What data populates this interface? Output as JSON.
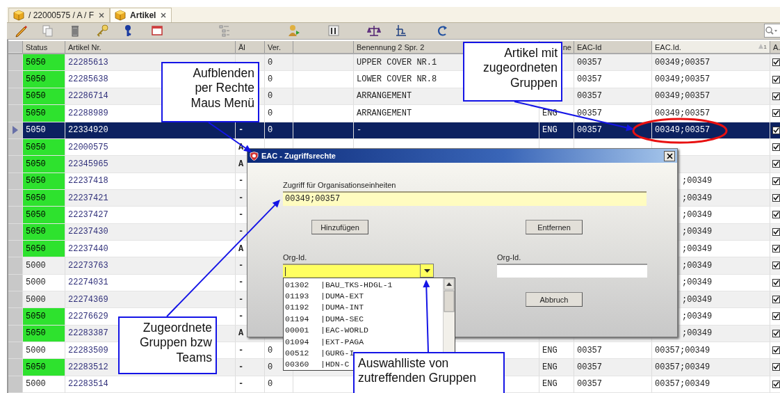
{
  "tabs": [
    {
      "label": "/ 22000575 / A / F",
      "selected": false
    },
    {
      "label": "Artikel",
      "selected": true
    }
  ],
  "table": {
    "columns": [
      {
        "label": "Status",
        "sorted": false
      },
      {
        "label": "Artikel Nr.",
        "sorted": false
      },
      {
        "label": "Äl",
        "sorted": false
      },
      {
        "label": "Ver.",
        "sorted": false
      },
      {
        "sorted": false
      },
      {
        "label": "Benennung 2 Spr. 2",
        "sorted": false
      },
      {
        "label": "ne",
        "sorted": false
      },
      {
        "label": "EAC-Id",
        "sorted": false
      },
      {
        "label": "EAC.Id.",
        "sorted": true,
        "sort_rank": "1"
      },
      {
        "label": "A.",
        "sorted": false
      }
    ],
    "rows": [
      {
        "selected": false,
        "status_highlight": true,
        "partly_covered": false,
        "checked": true,
        "cells": [
          "5050",
          "22285613",
          null,
          "0",
          null,
          "UPPER COVER NR.1",
          null,
          "00357",
          "00349;00357"
        ]
      },
      {
        "selected": false,
        "status_highlight": true,
        "partly_covered": false,
        "checked": true,
        "cells": [
          "5050",
          "22285638",
          null,
          "0",
          null,
          "LOWER COVER NR.8",
          null,
          "00357",
          "00349;00357"
        ]
      },
      {
        "selected": false,
        "status_highlight": true,
        "partly_covered": false,
        "checked": true,
        "cells": [
          "5050",
          "22286714",
          null,
          "0",
          null,
          "ARRANGEMENT",
          null,
          "00357",
          "00349;00357"
        ]
      },
      {
        "selected": false,
        "status_highlight": true,
        "partly_covered": false,
        "checked": true,
        "cells": [
          "5050",
          "22288989",
          null,
          "0",
          null,
          "ARRANGEMENT",
          "ENG",
          "00357",
          "00349;00357"
        ]
      },
      {
        "selected": true,
        "status_highlight": false,
        "partly_covered": false,
        "checked": true,
        "cells": [
          "5050",
          "22334920",
          "-",
          "0",
          null,
          "-",
          "ENG",
          "00357",
          "00349;00357"
        ]
      },
      {
        "selected": false,
        "status_highlight": true,
        "partly_covered": false,
        "checked": true,
        "cells": [
          "5050",
          "22000575",
          "A",
          null,
          null,
          null,
          null,
          null,
          null
        ]
      },
      {
        "selected": false,
        "status_highlight": true,
        "partly_covered": false,
        "checked": true,
        "cells": [
          "5050",
          "22345965",
          "A",
          null,
          null,
          null,
          null,
          null,
          null
        ]
      },
      {
        "selected": false,
        "status_highlight": true,
        "partly_covered": true,
        "checked": true,
        "cells": [
          "5050",
          "22237418",
          "-",
          null,
          null,
          null,
          null,
          null,
          ";00349"
        ]
      },
      {
        "selected": false,
        "status_highlight": true,
        "partly_covered": true,
        "checked": true,
        "cells": [
          "5050",
          "22237421",
          "-",
          null,
          null,
          null,
          null,
          null,
          ";00349"
        ]
      },
      {
        "selected": false,
        "status_highlight": true,
        "partly_covered": true,
        "checked": true,
        "cells": [
          "5050",
          "22237427",
          "-",
          null,
          null,
          null,
          null,
          null,
          ";00349"
        ]
      },
      {
        "selected": false,
        "status_highlight": true,
        "partly_covered": true,
        "checked": true,
        "cells": [
          "5050",
          "22237430",
          "-",
          null,
          null,
          null,
          null,
          null,
          ";00349"
        ]
      },
      {
        "selected": false,
        "status_highlight": true,
        "partly_covered": true,
        "checked": true,
        "cells": [
          "5050",
          "22237440",
          "A",
          null,
          null,
          null,
          null,
          null,
          ";00349"
        ]
      },
      {
        "selected": false,
        "status_highlight": false,
        "partly_covered": true,
        "checked": true,
        "cells": [
          "5000",
          "22273763",
          "-",
          null,
          null,
          null,
          null,
          null,
          ";00349"
        ]
      },
      {
        "selected": false,
        "status_highlight": false,
        "partly_covered": true,
        "checked": true,
        "cells": [
          "5000",
          "22274031",
          "-",
          null,
          null,
          null,
          null,
          null,
          ";00349"
        ]
      },
      {
        "selected": false,
        "status_highlight": false,
        "partly_covered": true,
        "checked": true,
        "cells": [
          "5000",
          "22274369",
          "-",
          null,
          null,
          null,
          null,
          null,
          ";00349"
        ]
      },
      {
        "selected": false,
        "status_highlight": true,
        "partly_covered": true,
        "checked": true,
        "cells": [
          "5050",
          "22276629",
          "-",
          null,
          null,
          null,
          null,
          null,
          ";00349"
        ]
      },
      {
        "selected": false,
        "status_highlight": true,
        "partly_covered": true,
        "checked": true,
        "cells": [
          "5050",
          "22283387",
          "A",
          null,
          null,
          null,
          null,
          null,
          ";00349"
        ]
      },
      {
        "selected": false,
        "status_highlight": false,
        "partly_covered": false,
        "checked": true,
        "cells": [
          "5000",
          "22283509",
          "-",
          "0",
          null,
          null,
          "ENG",
          "00357",
          "00357;00349"
        ]
      },
      {
        "selected": false,
        "status_highlight": true,
        "partly_covered": false,
        "checked": true,
        "cells": [
          "5050",
          "22283512",
          "-",
          "0",
          null,
          null,
          "ENG",
          "00357",
          "00357;00349"
        ]
      },
      {
        "selected": false,
        "status_highlight": false,
        "partly_covered": false,
        "checked": true,
        "cells": [
          "5000",
          "22283514",
          "-",
          "0",
          null,
          null,
          "ENG",
          "00357",
          "00357;00349"
        ]
      }
    ]
  },
  "dialog": {
    "title": "EAC - Zugriffsrechte",
    "access_label": "Zugriff für Organisationseinheiten",
    "access_value": "00349;00357",
    "buttons": [
      "Hinzufügen",
      "Entfernen",
      "Abbruch"
    ],
    "org_left_label": "Org-Id.",
    "org_right_label": "Org-Id.",
    "list_items": [
      {
        "code": "01302",
        "name": "|BAU_TKS-HDGL-1"
      },
      {
        "code": "01193",
        "name": "|DUMA-EXT"
      },
      {
        "code": "01192",
        "name": "|DUMA-INT"
      },
      {
        "code": "01194",
        "name": "|DUMA-SEC"
      },
      {
        "code": "00001",
        "name": "|EAC-WORLD"
      },
      {
        "code": "01094",
        "name": "|EXT-PAGA"
      },
      {
        "code": "00512",
        "name": "|GURG-I"
      },
      {
        "code": "00360",
        "name": "|HDN-C"
      }
    ]
  },
  "annotations": [
    {
      "lines": [
        "Aufblenden",
        "per Rechte",
        "Maus Menü"
      ]
    },
    {
      "lines": [
        "Artikel mit",
        "zugeordneten",
        "Gruppen"
      ]
    },
    {
      "lines": [
        "Zugeordnete",
        "Gruppen bzw",
        "Teams"
      ]
    },
    {
      "lines": [
        "Auswahlliste von",
        "zutreffenden Gruppen"
      ]
    }
  ]
}
